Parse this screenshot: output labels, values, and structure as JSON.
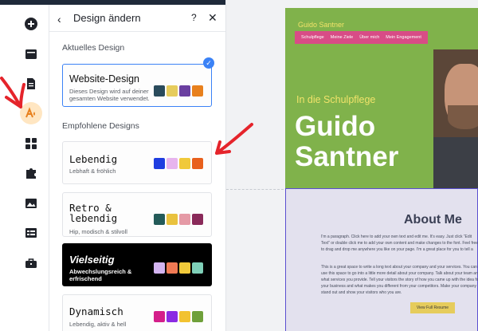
{
  "panel": {
    "title": "Design ändern",
    "back_glyph": "‹",
    "help_glyph": "?",
    "close_glyph": "✕",
    "current_label": "Aktuelles Design",
    "recommended_label": "Empfohlene Designs",
    "check_glyph": "✓"
  },
  "current_design": {
    "title": "Website-Design",
    "subtitle": "Dieses Design wird auf deiner gesamten Website verwendet.",
    "swatches": [
      "#2a4b5c",
      "#e6cc5c",
      "#6a3fa0",
      "#e8801d"
    ]
  },
  "designs": [
    {
      "title": "Lebendig",
      "subtitle": "Lebhaft & fröhlich",
      "swatches": [
        "#1f3ee0",
        "#e7b4ee",
        "#f0c93a",
        "#e8601c"
      ],
      "dark": false
    },
    {
      "title": "Retro & lebendig",
      "subtitle": "Hip, modisch & stilvoll",
      "swatches": [
        "#245b59",
        "#e9c23e",
        "#e59aa6",
        "#8a2a5a"
      ],
      "dark": false
    },
    {
      "title": "Vielseitig",
      "subtitle": "Abwechslungsreich & erfrischend",
      "swatches": [
        "#d3b4f0",
        "#f07a54",
        "#f0c93a",
        "#7fd0b8"
      ],
      "dark": true
    },
    {
      "title": "Dynamisch",
      "subtitle": "Lebendig, aktiv & hell",
      "swatches": [
        "#d41f8a",
        "#8b2be3",
        "#f2c230",
        "#6fa03a"
      ],
      "dark": false
    }
  ],
  "rail_icons": [
    "add-icon",
    "pages-icon",
    "document-icon",
    "design-icon",
    "apps-icon",
    "puzzle-icon",
    "image-icon",
    "table-icon",
    "briefcase-icon"
  ],
  "site": {
    "logo": "Guido Santner",
    "menu": [
      "Schulpflege",
      "Meine Ziele",
      "Über mich",
      "Mein Engagement"
    ],
    "kicker": "In die Schulpflege",
    "name_line1": "Guido",
    "name_line2": "Santner",
    "about_title": "About Me",
    "about_p1": "I'm a paragraph. Click here to add your own text and edit me. It's easy. Just click “Edit Text” or double click me to add your own content and make changes to the font. Feel free to drag and drop me anywhere you like on your page. I'm a great place for you to tell a story and let your users know a little more about you.",
    "about_p2": "This is a great space to write a long text about your company and your services. You can use this space to go into a little more detail about your company. Talk about your team and what services you provide. Tell your visitors the story of how you came up with the idea for your business and what makes you different from your competitors. Make your company stand out and show your visitors who you are.",
    "resume_label": "View Full Resume"
  },
  "colors": {
    "accent": "#3b82f6",
    "active_rail": "#ffe6c2",
    "hero_green": "#80b24b",
    "menu_pink": "#d84c86",
    "annotation_red": "#e5242b"
  }
}
